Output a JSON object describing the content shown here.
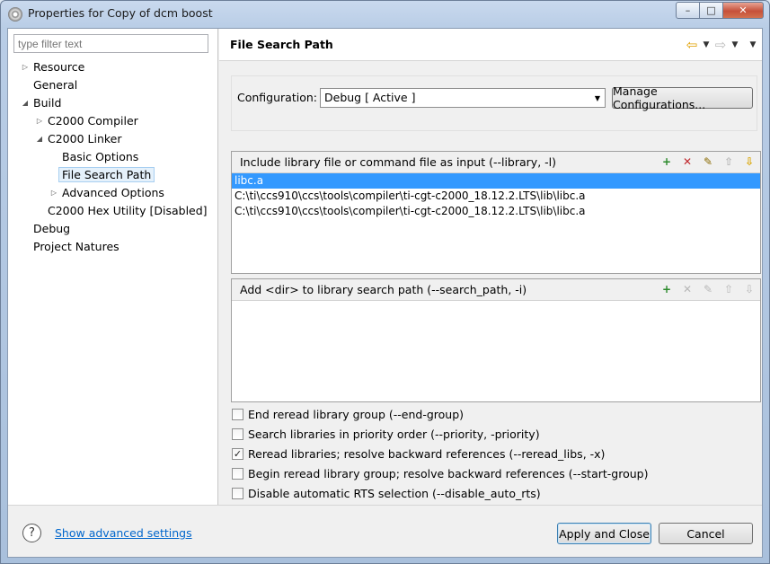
{
  "window": {
    "title": "Properties for Copy of dcm boost"
  },
  "filter": {
    "placeholder": "type filter text"
  },
  "tree": [
    {
      "label": "Resource"
    },
    {
      "label": "General"
    },
    {
      "label": "Build"
    },
    {
      "label": "C2000 Compiler"
    },
    {
      "label": "C2000 Linker"
    },
    {
      "label": "Basic Options"
    },
    {
      "label": "File Search Path"
    },
    {
      "label": "Advanced Options"
    },
    {
      "label": "C2000 Hex Utility  [Disabled]"
    },
    {
      "label": "Debug"
    },
    {
      "label": "Project Natures"
    }
  ],
  "page": {
    "title": "File Search Path"
  },
  "configuration": {
    "label": "Configuration:",
    "selected": "Debug  [ Active ]",
    "manage_label": "Manage Configurations..."
  },
  "library_list": {
    "header": "Include library file or command file as input (--library, -l)",
    "items": [
      "libc.a",
      "C:\\ti\\ccs910\\ccs\\tools\\compiler\\ti-cgt-c2000_18.12.2.LTS\\lib\\libc.a",
      "C:\\ti\\ccs910\\ccs\\tools\\compiler\\ti-cgt-c2000_18.12.2.LTS\\lib\\libc.a"
    ]
  },
  "search_path_list": {
    "header": "Add <dir> to library search path (--search_path, -i)",
    "items": []
  },
  "options": [
    {
      "label": "End reread library group (--end-group)",
      "checked": false
    },
    {
      "label": "Search libraries in priority order (--priority, -priority)",
      "checked": false
    },
    {
      "label": "Reread libraries; resolve backward references (--reread_libs, -x)",
      "checked": true
    },
    {
      "label": "Begin reread library group; resolve backward references (--start-group)",
      "checked": false
    },
    {
      "label": "Disable automatic RTS selection (--disable_auto_rts)",
      "checked": false
    }
  ],
  "footer": {
    "help_glyph": "?",
    "advanced_link": "Show advanced settings",
    "apply_label": "Apply and Close",
    "cancel_label": "Cancel"
  },
  "glyphs": {
    "minimize": "–",
    "maximize": "□",
    "close": "✕",
    "check": "✓",
    "back": "⇦",
    "forward": "⇨",
    "dropdown": "▼"
  }
}
